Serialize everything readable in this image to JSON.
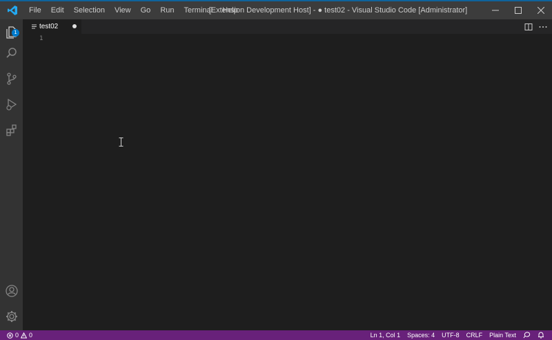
{
  "colors": {
    "titlebar": "#3c3c3c",
    "activitybar": "#333333",
    "editor": "#1e1e1e",
    "statusbar": "#68217a",
    "accent": "#007acc"
  },
  "titlebar": {
    "menu": [
      "File",
      "Edit",
      "Selection",
      "View",
      "Go",
      "Run",
      "Terminal",
      "Help"
    ],
    "title": "[Extension Development Host] - ● test02 - Visual Studio Code [Administrator]"
  },
  "activitybar": {
    "items": [
      "explorer-icon",
      "search-icon",
      "source-control-icon",
      "run-debug-icon",
      "extensions-icon"
    ],
    "explorer_badge": "1",
    "bottom": [
      "account-icon",
      "settings-gear-icon"
    ]
  },
  "tabs": [
    {
      "label": "test02",
      "dirty": true
    }
  ],
  "editor": {
    "line_numbers": [
      "1"
    ]
  },
  "statusbar": {
    "errors": "0",
    "warnings": "0",
    "position": "Ln 1, Col 1",
    "spaces": "Spaces: 4",
    "encoding": "UTF-8",
    "eol": "CRLF",
    "language": "Plain Text"
  }
}
